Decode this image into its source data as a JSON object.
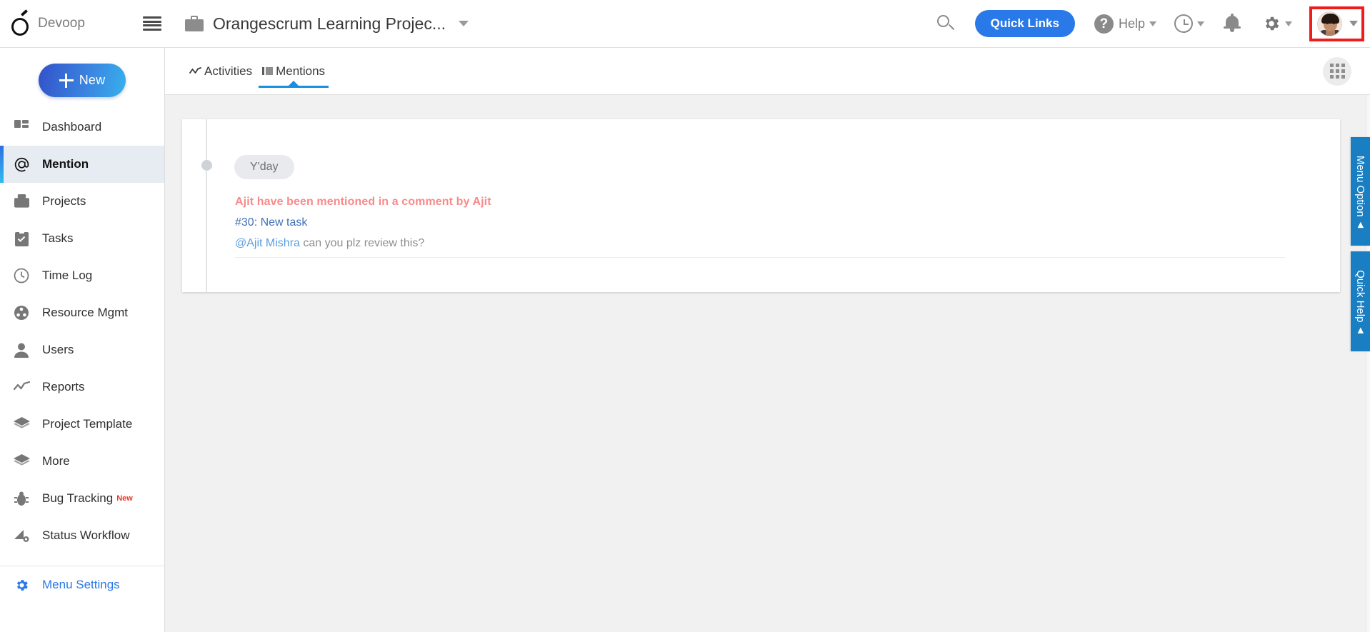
{
  "header": {
    "logo_icon": "orangescrum-o-logo",
    "brand_name": "Devoop",
    "hamburger_icon": "hamburger-menu-icon",
    "project_icon": "briefcase-icon",
    "project_title": "Orangescrum Learning Projec...",
    "project_caret_icon": "chevron-down-icon",
    "search_icon": "search-icon",
    "quick_links_label": "Quick Links",
    "help_label": "Help",
    "help_icon": "question-mark-icon",
    "help_caret_icon": "caret-down-icon",
    "clock_icon": "clock-icon",
    "clock_caret_icon": "caret-down-icon",
    "bell_icon": "bell-notification-icon",
    "gear_icon": "gear-settings-icon",
    "gear_caret_icon": "caret-down-icon",
    "avatar_icon": "user-avatar",
    "avatar_caret_icon": "caret-down-icon",
    "highlight_color": "#ef1c1c",
    "accent_color": "#2979e8"
  },
  "sidebar": {
    "new_button": {
      "label": "New",
      "icon": "plus-icon"
    },
    "items": [
      {
        "label": "Dashboard",
        "icon": "dashboard-grid-icon",
        "active": false
      },
      {
        "label": "Mention",
        "icon": "at-sign-icon",
        "active": true
      },
      {
        "label": "Projects",
        "icon": "briefcase-icon",
        "active": false
      },
      {
        "label": "Tasks",
        "icon": "clipboard-check-icon",
        "active": false
      },
      {
        "label": "Time Log",
        "icon": "clock-icon",
        "active": false
      },
      {
        "label": "Resource Mgmt",
        "icon": "resource-nodes-icon",
        "active": false
      },
      {
        "label": "Users",
        "icon": "person-icon",
        "active": false
      },
      {
        "label": "Reports",
        "icon": "line-chart-icon",
        "active": false
      },
      {
        "label": "Project Template",
        "icon": "layers-icon",
        "active": false
      },
      {
        "label": "More",
        "icon": "layers-icon",
        "active": false
      },
      {
        "label": "Bug Tracking",
        "icon": "bug-icon",
        "active": false,
        "badge": "New"
      },
      {
        "label": "Status Workflow",
        "icon": "workflow-icon",
        "active": false
      }
    ],
    "settings": {
      "label": "Menu Settings",
      "icon": "gear-settings-icon"
    },
    "active_color": "#e6ecf2",
    "badge_color": "#e8392b"
  },
  "tabbar": {
    "tabs": [
      {
        "label": "Activities",
        "icon": "activity-line-icon",
        "active": false
      },
      {
        "label": "Mentions",
        "icon": "bar-blocks-icon",
        "active": true
      }
    ],
    "grid_button_icon": "apps-grid-icon",
    "active_underline_color": "#1a8fe0"
  },
  "main": {
    "mention_card": {
      "date_pill": "Y'day",
      "headline": "Ajit have been mentioned in a comment by Ajit",
      "task_link": "#30: New task",
      "comment_user": "@Ajit Mishra",
      "comment_text": " can you plz review this?",
      "headline_color": "#fa8a8a",
      "link_color": "#4171b8",
      "user_color": "#5c9ee0"
    }
  },
  "right_tabs": [
    {
      "label": "Menu Option",
      "arrow": "◀",
      "id": "menu-option"
    },
    {
      "label": "Quick Help",
      "arrow": "◀",
      "id": "quick-help"
    }
  ]
}
